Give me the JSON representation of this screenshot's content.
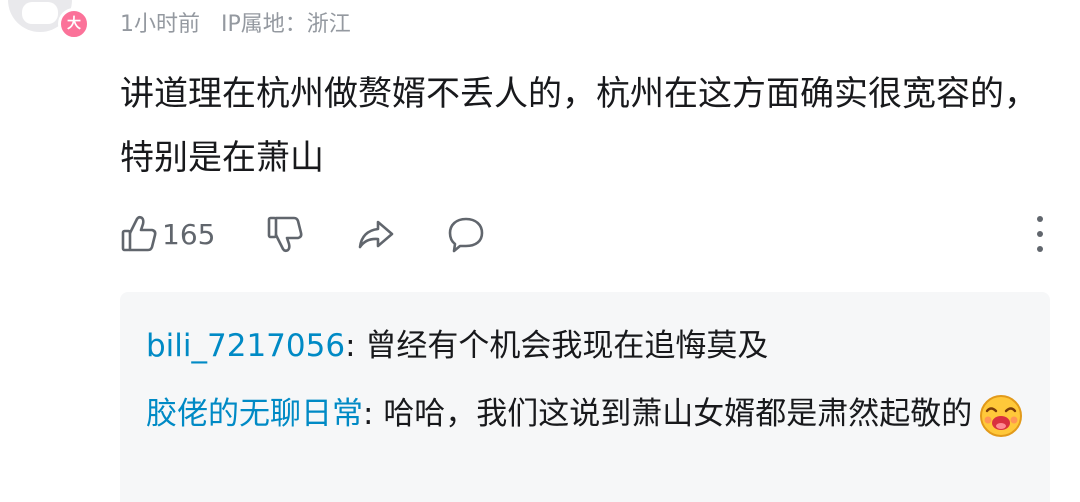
{
  "comment": {
    "vip_badge": "大",
    "time": "1小时前",
    "ip_location": "IP属地：浙江",
    "text": "讲道理在杭州做赘婿不丢人的，杭州在这方面确实很宽容的，特别是在萧山",
    "like_count": "165",
    "icons": [
      "thumbs-up-icon",
      "thumbs-down-icon",
      "share-icon",
      "reply-icon",
      "more-vertical-icon"
    ]
  },
  "replies": [
    {
      "user": "bili_7217056",
      "separator": ": ",
      "text": "曾经有个机会我现在追悔莫及"
    },
    {
      "user": "胶佬的无聊日常",
      "separator": ": ",
      "text": "哈哈，我们这说到萧山女婿都是肃然起敬的",
      "emoji": "laughing-emoji"
    }
  ],
  "colors": {
    "username_blue": "#008ac5",
    "meta_gray": "#9499a0",
    "reply_background": "#f6f7f8",
    "vip_pink": "#fb7299"
  }
}
